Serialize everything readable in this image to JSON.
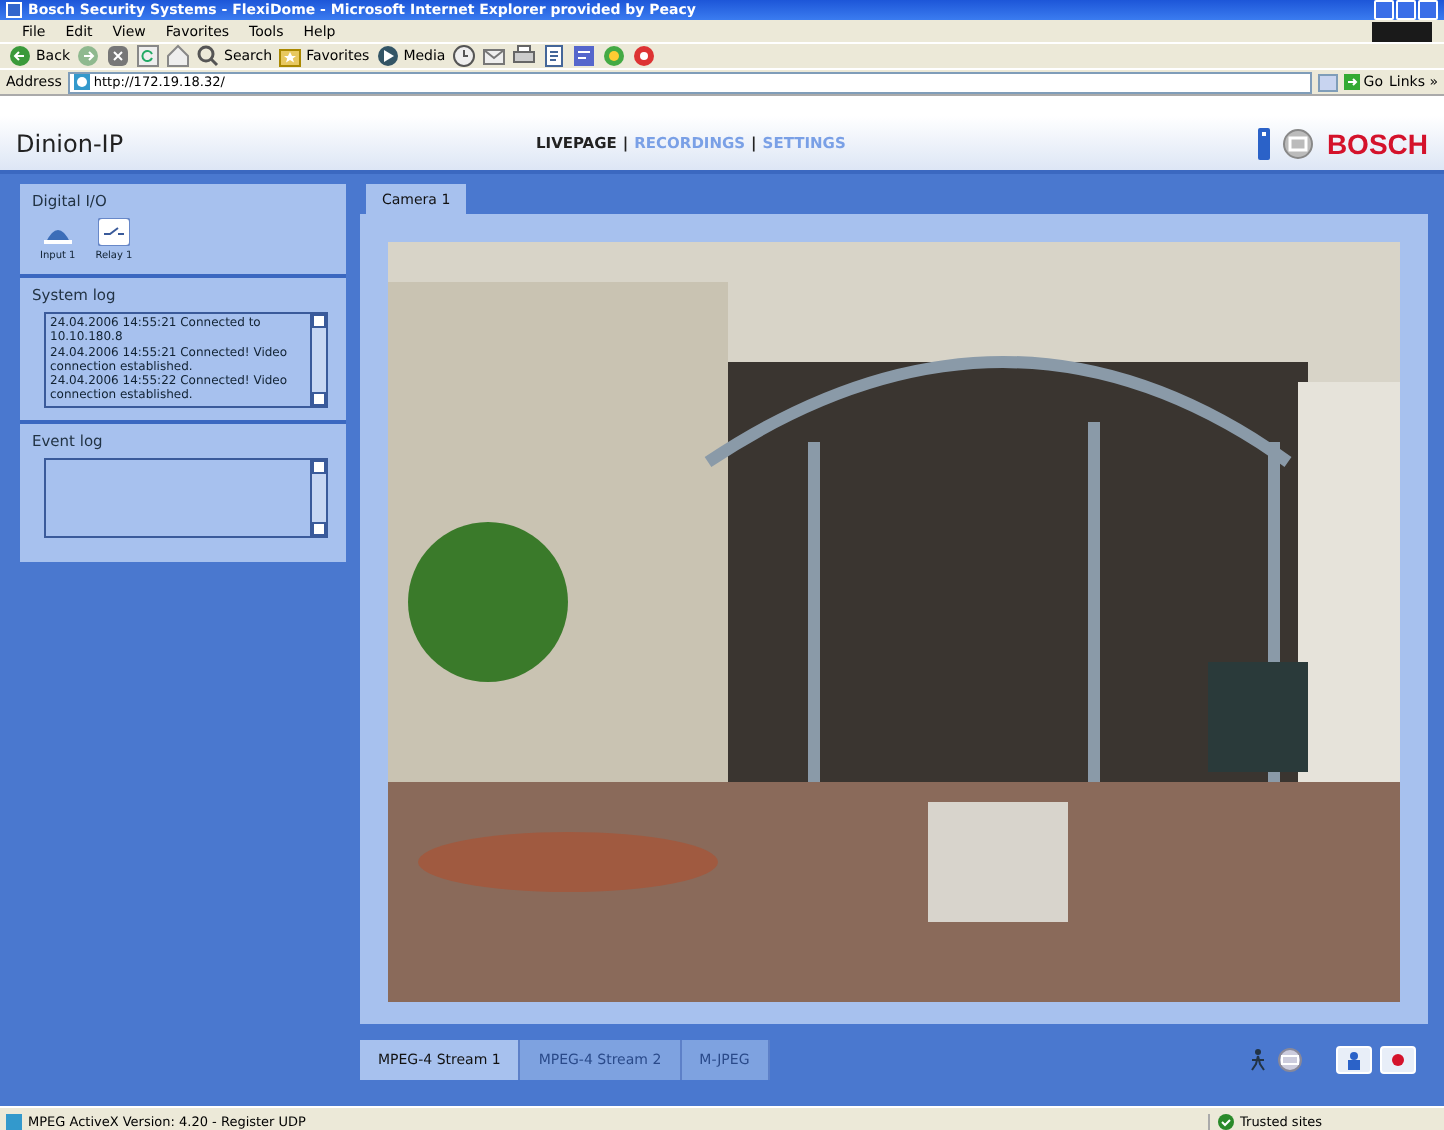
{
  "window": {
    "title": "Bosch Security Systems - FlexiDome - Microsoft Internet Explorer provided by Peacy"
  },
  "menu": [
    "File",
    "Edit",
    "View",
    "Favorites",
    "Tools",
    "Help"
  ],
  "toolbar": [
    {
      "kind": "back",
      "label": "Back"
    },
    {
      "kind": "forward"
    },
    {
      "kind": "stop"
    },
    {
      "kind": "refresh"
    },
    {
      "kind": "home"
    },
    {
      "kind": "search",
      "label": "Search"
    },
    {
      "kind": "favorites",
      "label": "Favorites"
    },
    {
      "kind": "media",
      "label": "Media"
    },
    {
      "kind": "history"
    },
    {
      "kind": "mail"
    },
    {
      "kind": "print"
    },
    {
      "kind": "edit"
    },
    {
      "kind": "discuss"
    },
    {
      "kind": "messenger"
    },
    {
      "kind": "research"
    }
  ],
  "address": {
    "label": "Address",
    "value": "http://172.19.18.32/",
    "go": "Go",
    "links": "Links »"
  },
  "app": {
    "title": "Dinion-IP",
    "nav": [
      {
        "label": "LIVEPAGE",
        "selected": true
      },
      {
        "label": "RECORDINGS",
        "selected": false
      },
      {
        "label": "SETTINGS",
        "selected": false
      }
    ],
    "separator": "|",
    "brand": "BOSCH"
  },
  "digital_io": {
    "title": "Digital I/O",
    "items": [
      {
        "kind": "input",
        "label": "Input 1"
      },
      {
        "kind": "relay",
        "label": "Relay 1"
      }
    ]
  },
  "system_log": {
    "title": "System log",
    "lines": [
      "24.04.2006 14:55:21 Connected to 10.10.180.8",
      "24.04.2006 14:55:21 Connected! Video connection established.",
      "24.04.2006 14:55:22 Connected! Video connection established."
    ]
  },
  "event_log": {
    "title": "Event log"
  },
  "camera_tabs": [
    {
      "label": "Camera 1",
      "selected": true
    }
  ],
  "stream_tabs": [
    {
      "label": "MPEG-4 Stream 1",
      "selected": true
    },
    {
      "label": "MPEG-4 Stream 2",
      "selected": false
    },
    {
      "label": "M-JPEG",
      "selected": false
    }
  ],
  "status_bar": {
    "text": "MPEG ActiveX Version: 4.20 - Register UDP",
    "zone": "Trusted sites"
  }
}
